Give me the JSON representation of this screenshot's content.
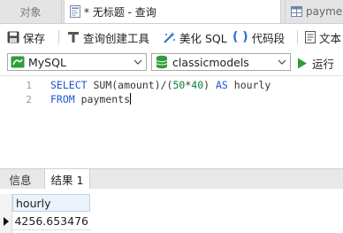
{
  "tabs": {
    "objects": "对象",
    "query": "* 无标题 - 查询",
    "payments": "paymen"
  },
  "toolbar": {
    "save": "保存",
    "query_builder": "查询创建工具",
    "beautify_sql": "美化 SQL",
    "code_snippet": "代码段",
    "text": "文本"
  },
  "connection": {
    "engine": "MySQL",
    "database": "classicmodels",
    "run": "运行"
  },
  "editor": {
    "line_numbers": [
      "1",
      "2"
    ],
    "line1": {
      "select": "SELECT",
      "sum_open": " SUM(amount)/(",
      "n1": "50",
      "times": "*",
      "n2": "40",
      "close": ") ",
      "as": "AS",
      "alias": " hourly"
    },
    "line2": {
      "from": "FROM",
      "table": " payments"
    }
  },
  "results": {
    "tab_info": "信息",
    "tab_result": "结果 1",
    "columns": [
      "hourly"
    ],
    "rows": [
      [
        "4256.653476"
      ]
    ]
  },
  "colors": {
    "keyword": "#1d56d0",
    "number": "#0a7d3a",
    "accent_green": "#2e9d3a",
    "accent_blue": "#2f6fd0"
  },
  "icons": [
    "grid-icon",
    "query-tab-icon",
    "save-icon",
    "query-builder-icon",
    "beautify-icon",
    "code-snippet-icon",
    "text-icon",
    "mysql-icon",
    "database-icon",
    "run-icon",
    "chevron-down-icon"
  ]
}
